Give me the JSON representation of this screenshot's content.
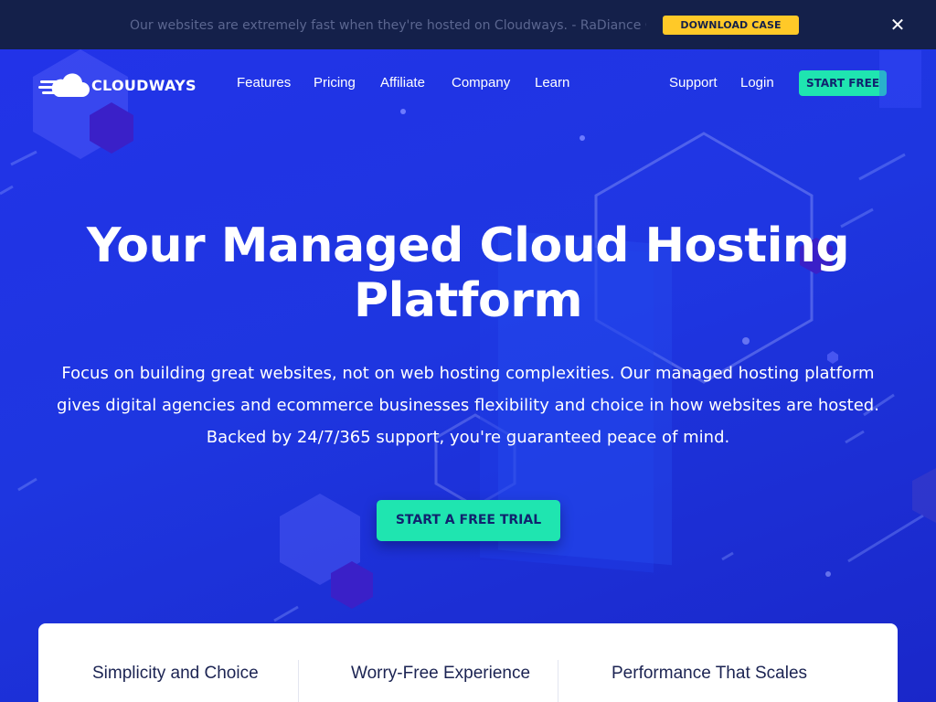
{
  "promo": {
    "text": "Our websites are extremely fast when they're hosted on Cloudways. - RaDiance Consei",
    "button_label": "DOWNLOAD CASE STUDY",
    "close_glyph": "✕"
  },
  "nav": {
    "brand": "CLOUDWAYS",
    "items": [
      {
        "label": "Features"
      },
      {
        "label": "Pricing"
      },
      {
        "label": "Affiliate"
      },
      {
        "label": "Company"
      },
      {
        "label": "Learn"
      }
    ],
    "support_label": "Support",
    "login_label": "Login",
    "start_free_label": "START FREE"
  },
  "hero": {
    "headline_line1": "Your Managed Cloud Hosting",
    "headline_line2": "Platform",
    "sub_line1": "Focus on building great websites, not on web hosting complexities. Our managed hosting platform",
    "sub_line2": "gives digital agencies and ecommerce businesses flexibility and choice in how websites are hosted.",
    "sub_line3": "Backed by 24/7/365 support, you're guaranteed peace of mind.",
    "cta_label": "START A FREE TRIAL"
  },
  "features": [
    {
      "title": "Simplicity and Choice"
    },
    {
      "title": "Worry-Free Experience"
    },
    {
      "title": "Performance That Scales"
    }
  ],
  "colors": {
    "promo_bg": "#14204a",
    "hero_bg": "#1f2fe6",
    "accent_green": "#1fe5b0",
    "promo_yellow": "#ffc928"
  },
  "icons": [
    "cloudways-logo-icon",
    "close-icon"
  ]
}
